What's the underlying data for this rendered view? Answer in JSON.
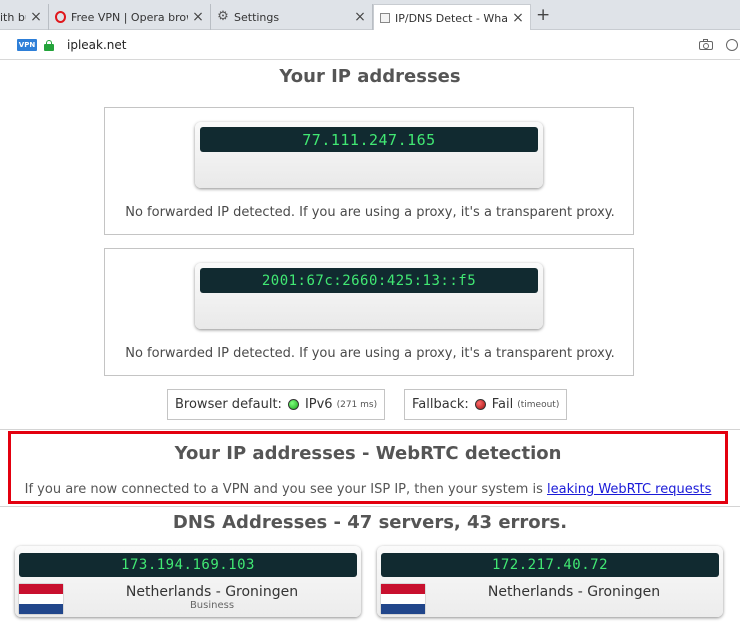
{
  "browser": {
    "tabs": [
      {
        "title": "ith bu",
        "icon": "generic-page-icon",
        "active": false
      },
      {
        "title": "Free VPN | Opera browser",
        "icon": "opera-icon",
        "active": false
      },
      {
        "title": "Settings",
        "icon": "gear-icon",
        "active": false
      },
      {
        "title": "IP/DNS Detect - What is yo",
        "icon": "ipleak-icon",
        "active": true
      }
    ],
    "new_tab": "+",
    "vpn_badge": "VPN",
    "url": "ipleak.net"
  },
  "page": {
    "ip_title": "Your IP addresses",
    "ipv4": {
      "address": "77.111.247.165",
      "note": "No forwarded IP detected. If you are using a proxy, it's a transparent proxy."
    },
    "ipv6": {
      "address": "2001:67c:2660:425:13::f5",
      "note": "No forwarded IP detected. If you are using a proxy, it's a transparent proxy."
    },
    "browser_default": {
      "label": "Browser default:",
      "value": "IPv6",
      "timing": "(271 ms)",
      "status_color": "#1aa51a"
    },
    "fallback": {
      "label": "Fallback:",
      "value": "Fail",
      "timing": "(timeout)",
      "status_color": "#a40f0f"
    },
    "webrtc": {
      "title": "Your IP addresses - WebRTC detection",
      "text": "If you are now connected to a VPN and you see your ISP IP, then your system is",
      "link": "leaking WebRTC requests",
      "highlight_color": "#e3000f"
    },
    "dns_title": "DNS Addresses - 47 servers, 43 errors.",
    "dns_servers": [
      {
        "ip": "173.194.169.103",
        "location": "Netherlands - Groningen",
        "isp": "Business",
        "flag": "netherlands-flag"
      },
      {
        "ip": "172.217.40.72",
        "location": "Netherlands - Groningen",
        "isp": "",
        "flag": "netherlands-flag"
      }
    ]
  },
  "colors": {
    "lcd_background": "#112a30",
    "lcd_text": "#41e873",
    "link": "#1a1ad8"
  }
}
